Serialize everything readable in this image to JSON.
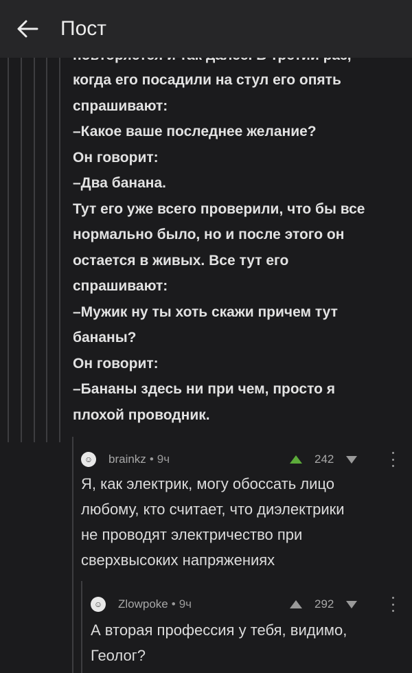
{
  "header": {
    "title": "Пост"
  },
  "main_comment": {
    "cut_line": "повторяется и так далее. В третий раз,",
    "lines": [
      "когда его посадили на стул его опять",
      "спрашивают:",
      "–Какое ваше последнее желание?",
      "Он говорит:",
      "–Два банана.",
      "Тут его уже всего проверили, что бы все",
      "нормально было, но и после этого он",
      "остается в живых. Все тут его",
      "спрашивают:",
      "–Мужик ну ты хоть скажи причем тут",
      "бананы?",
      "Он говорит:",
      "–Бананы здесь ни при чем, просто я",
      "плохой проводник."
    ]
  },
  "replies": [
    {
      "author": "brainkz",
      "time": "9ч",
      "separator": "•",
      "score": "242",
      "vote_color": "#5cab3a",
      "lines": [
        "Я, как электрик, могу обоссать лицо",
        "любому, кто считает, что диэлектрики",
        "не проводят электричество при",
        "сверхвысоких напряжениях"
      ]
    },
    {
      "author": "Zlowpoke",
      "time": "9ч",
      "separator": "•",
      "score": "292",
      "vote_color": "#9a9a9a",
      "lines": [
        "А вторая профессия у тебя, видимо,",
        "Геолог?"
      ]
    }
  ]
}
